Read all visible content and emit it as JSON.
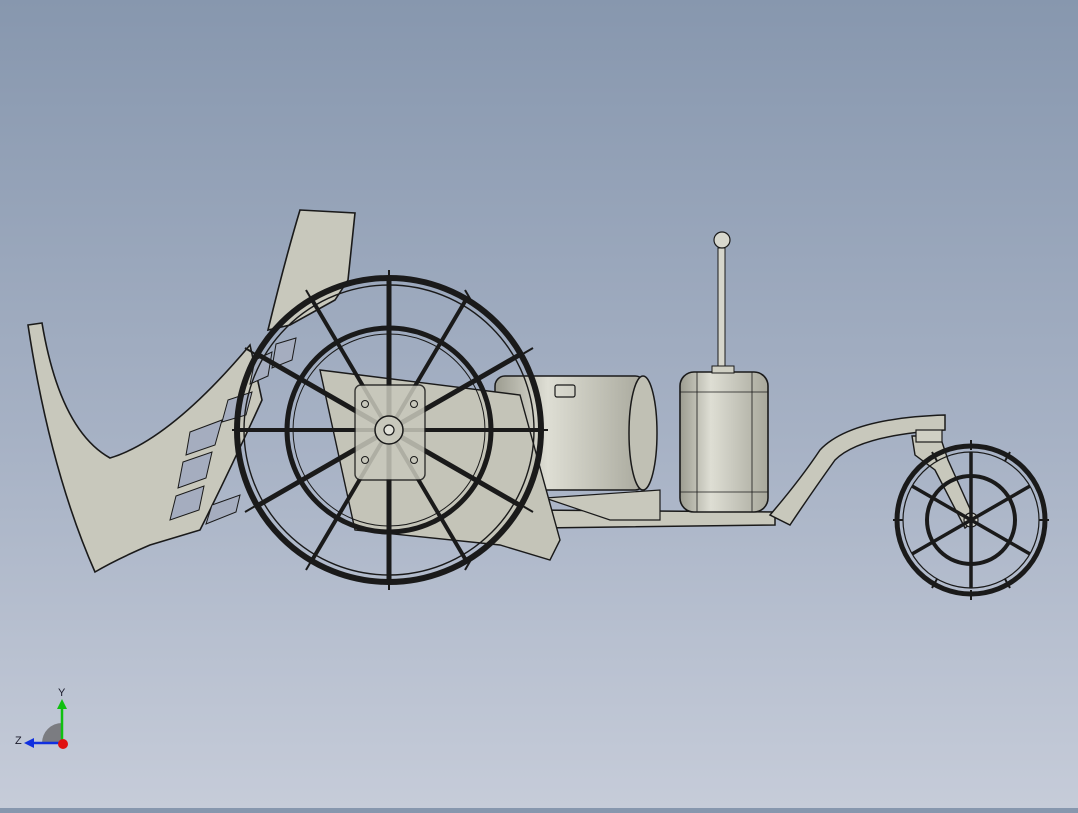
{
  "viewport": {
    "background_top": "#8797ae",
    "background_bottom": "#c6ccd9",
    "model_fill": "#c8c8bc",
    "edge_color": "#1a1a1a"
  },
  "triad": {
    "x_label": "",
    "y_label": "Y",
    "z_label": "Z",
    "y_color": "#10c010",
    "z_color": "#1030e0",
    "x_color": "#e01010"
  }
}
